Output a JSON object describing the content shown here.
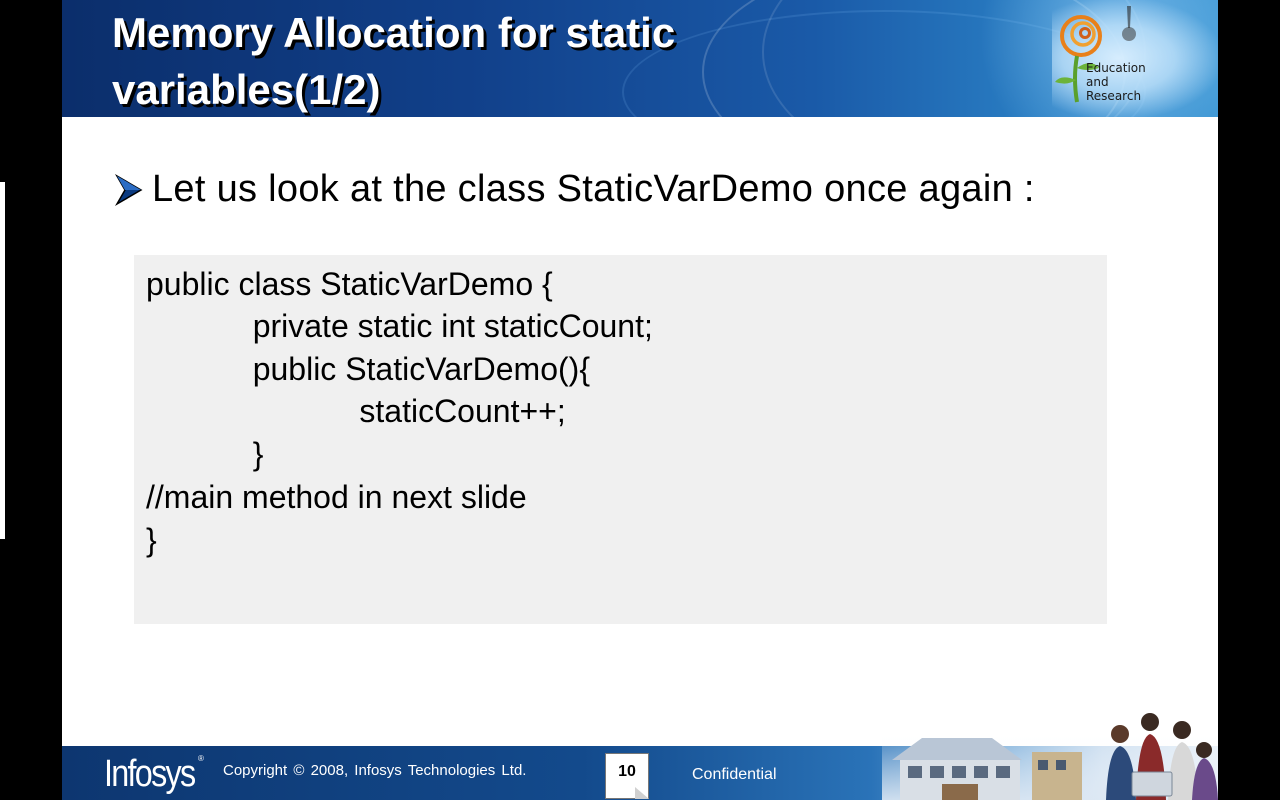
{
  "header": {
    "title_line1": "Memory Allocation for static",
    "title_line2": "variables(1/2)",
    "logo_text": [
      "Education",
      "and",
      "Research"
    ]
  },
  "content": {
    "bullet": "Let us look at the class StaticVarDemo once again :",
    "code_lines": [
      "public class StaticVarDemo {",
      "            private static int staticCount;",
      "            public StaticVarDemo(){",
      "                        staticCount++;",
      "            }",
      "//main method in next slide",
      "}"
    ]
  },
  "footer": {
    "brand": "Infosys",
    "registered": "®",
    "copyright": "Copyright © 2008, Infosys Technologies Ltd.",
    "page_number": "10",
    "confidential": "Confidential"
  },
  "colors": {
    "header_blue": "#11408a",
    "code_background": "#f0f0f0",
    "footer_blue": "#134a8c"
  },
  "icons": [
    "bullet-arrow-icon",
    "education-research-logo-icon",
    "footer-photo"
  ]
}
